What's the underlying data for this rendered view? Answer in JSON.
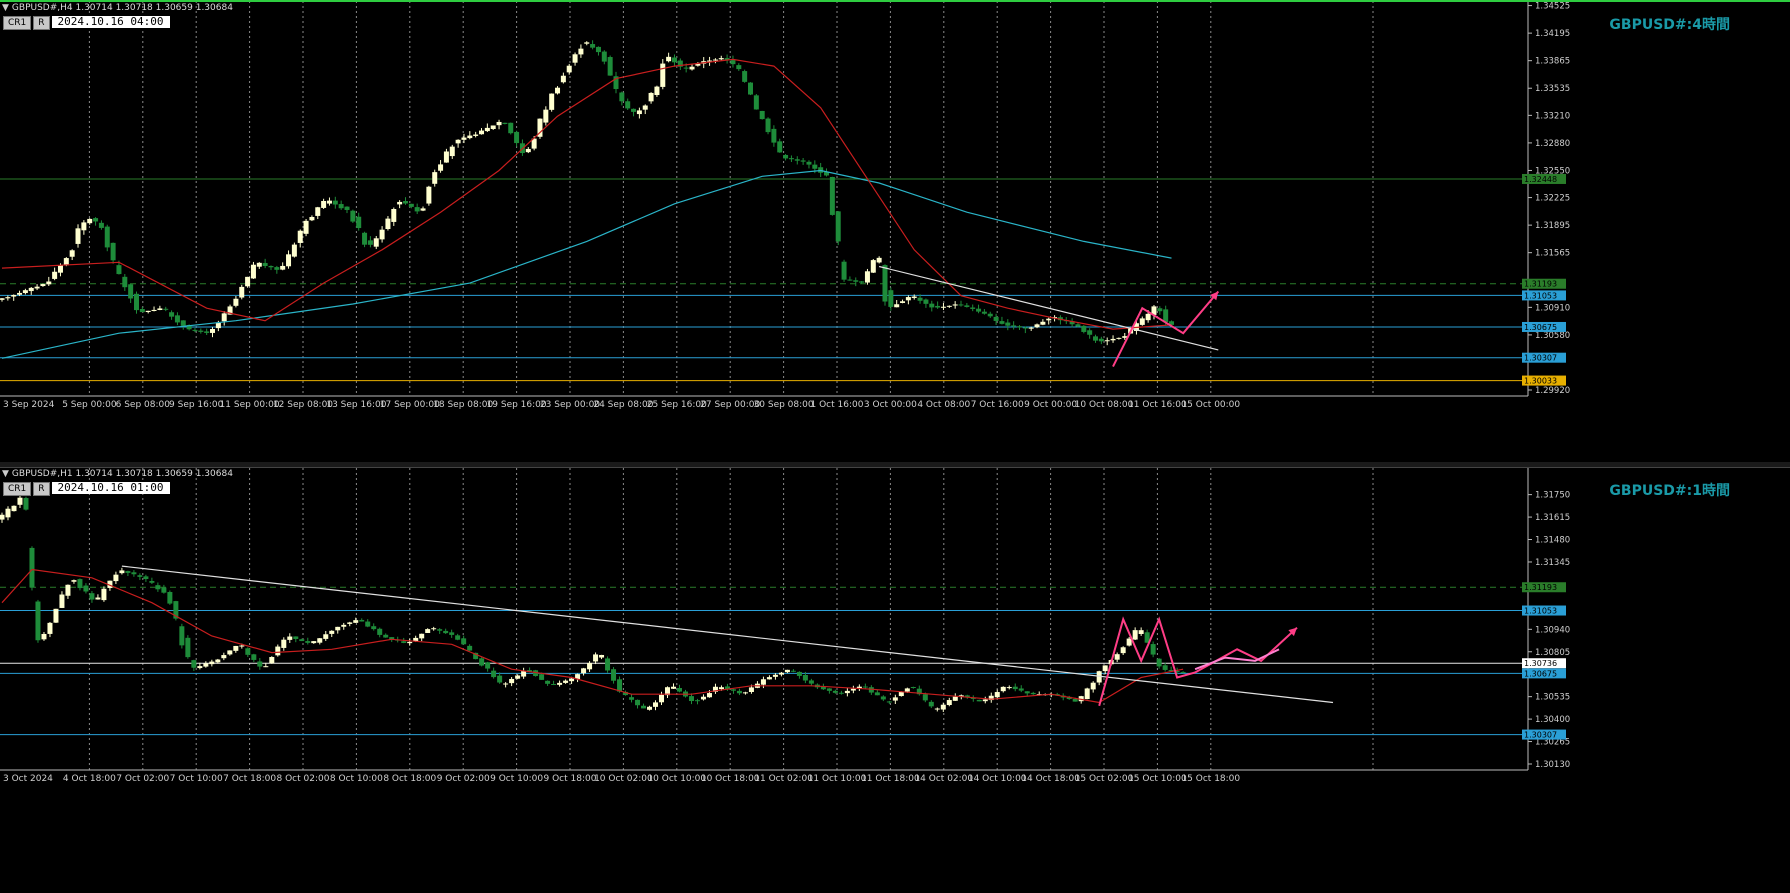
{
  "colors": {
    "bull": "#ffffd0",
    "bear": "#1e8c3a",
    "ma_short": "#c81e1e",
    "ma_long": "#2ab4c8",
    "level": "#2a9fd6",
    "green_line": "#2a7d2a",
    "trend": "#e0e0e0",
    "scenario": "#ff3d86",
    "scenario_alt": "#ff80d0",
    "low_line": "#e8b000"
  },
  "h4": {
    "header": "GBPUSD#,H4  1.30714 1.30718 1.30659 1.30684",
    "btn_cr": "CR1",
    "btn_r": "R",
    "datetime": "2024.10.16 04:00",
    "title": "GBPUSD#:4時間",
    "ylim": [
      1.2992,
      1.3452
    ],
    "y_ticks": [
      "1.34525",
      "1.34195",
      "1.33865",
      "1.33535",
      "1.33210",
      "1.32880",
      "1.32550",
      "1.32225",
      "1.31895",
      "1.31565",
      "1.30910",
      "1.30580",
      "1.29920"
    ],
    "x_labels": [
      "3 Sep 2024",
      "5 Sep 00:00",
      "6 Sep 08:00",
      "9 Sep 16:00",
      "11 Sep 00:00",
      "12 Sep 08:00",
      "13 Sep 16:00",
      "17 Sep 00:00",
      "18 Sep 08:00",
      "19 Sep 16:00",
      "23 Sep 00:00",
      "24 Sep 08:00",
      "25 Sep 16:00",
      "27 Sep 00:00",
      "30 Sep 08:00",
      "1 Oct 16:00",
      "3 Oct 00:00",
      "4 Oct 08:00",
      "7 Oct 16:00",
      "9 Oct 00:00",
      "10 Oct 08:00",
      "11 Oct 16:00",
      "15 Oct 00:00"
    ],
    "levels": [
      {
        "price": 1.32448,
        "label": "1.32448",
        "kind": "green"
      },
      {
        "price": 1.31193,
        "label": "1.31193",
        "kind": "green-dash"
      },
      {
        "price": 1.31053,
        "label": "1.31053",
        "kind": "blue"
      },
      {
        "price": 1.30675,
        "label": "1.30675",
        "kind": "blue"
      },
      {
        "price": 1.30307,
        "label": "1.30307",
        "kind": "blue"
      },
      {
        "price": 1.30033,
        "label": "1.30033",
        "kind": "yellow"
      }
    ]
  },
  "h1": {
    "header": "GBPUSD#,H1  1.30714 1.30718 1.30659 1.30684",
    "btn_cr": "CR1",
    "btn_r": "R",
    "datetime": "2024.10.16 01:00",
    "title": "GBPUSD#:1時間",
    "ylim": [
      1.3013,
      1.3185
    ],
    "y_ticks": [
      "1.31750",
      "1.31615",
      "1.31480",
      "1.31345",
      "1.30940",
      "1.30805",
      "1.30535",
      "1.30400",
      "1.30265",
      "1.30130"
    ],
    "x_labels": [
      "3 Oct 2024",
      "4 Oct 18:00",
      "7 Oct 02:00",
      "7 Oct 10:00",
      "7 Oct 18:00",
      "8 Oct 02:00",
      "8 Oct 10:00",
      "8 Oct 18:00",
      "9 Oct 02:00",
      "9 Oct 10:00",
      "9 Oct 18:00",
      "10 Oct 02:00",
      "10 Oct 10:00",
      "10 Oct 18:00",
      "11 Oct 02:00",
      "11 Oct 10:00",
      "11 Oct 18:00",
      "14 Oct 02:00",
      "14 Oct 10:00",
      "14 Oct 18:00",
      "15 Oct 02:00",
      "15 Oct 10:00",
      "15 Oct 18:00"
    ],
    "levels": [
      {
        "price": 1.31193,
        "label": "1.31193",
        "kind": "green-dash"
      },
      {
        "price": 1.31053,
        "label": "1.31053",
        "kind": "blue"
      },
      {
        "price": 1.30736,
        "label": "1.30736",
        "kind": "white"
      },
      {
        "price": 1.30675,
        "label": "1.30675",
        "kind": "blue"
      },
      {
        "price": 1.30307,
        "label": "1.30307",
        "kind": "blue"
      }
    ]
  },
  "chart_data": [
    {
      "type": "candlestick",
      "symbol": "GBPUSD#",
      "timeframe": "H4",
      "title": "GBPUSD#:4時間",
      "ylim": [
        1.2992,
        1.3452
      ],
      "path": [
        [
          0,
          1.31
        ],
        [
          8,
          1.312
        ],
        [
          12,
          1.3155
        ],
        [
          14,
          1.319
        ],
        [
          16,
          1.32
        ],
        [
          18,
          1.318
        ],
        [
          20,
          1.3135
        ],
        [
          24,
          1.3085
        ],
        [
          28,
          1.309
        ],
        [
          32,
          1.3065
        ],
        [
          36,
          1.306
        ],
        [
          40,
          1.3095
        ],
        [
          44,
          1.3145
        ],
        [
          48,
          1.3135
        ],
        [
          52,
          1.319
        ],
        [
          56,
          1.322
        ],
        [
          60,
          1.3205
        ],
        [
          63,
          1.316
        ],
        [
          66,
          1.319
        ],
        [
          68,
          1.322
        ],
        [
          72,
          1.3205
        ],
        [
          74,
          1.325
        ],
        [
          78,
          1.329
        ],
        [
          82,
          1.33
        ],
        [
          86,
          1.3315
        ],
        [
          90,
          1.327
        ],
        [
          94,
          1.334
        ],
        [
          97,
          1.3375
        ],
        [
          100,
          1.341
        ],
        [
          103,
          1.3395
        ],
        [
          106,
          1.334
        ],
        [
          109,
          1.332
        ],
        [
          112,
          1.335
        ],
        [
          114,
          1.3395
        ],
        [
          117,
          1.3375
        ],
        [
          120,
          1.3385
        ],
        [
          124,
          1.339
        ],
        [
          126,
          1.338
        ],
        [
          130,
          1.332
        ],
        [
          134,
          1.327
        ],
        [
          138,
          1.3265
        ],
        [
          142,
          1.3245
        ],
        [
          144,
          1.3125
        ],
        [
          148,
          1.312
        ],
        [
          150,
          1.316
        ],
        [
          152,
          1.309
        ],
        [
          156,
          1.3105
        ],
        [
          160,
          1.309
        ],
        [
          164,
          1.3095
        ],
        [
          168,
          1.3085
        ],
        [
          172,
          1.307
        ],
        [
          176,
          1.3065
        ],
        [
          180,
          1.308
        ],
        [
          184,
          1.307
        ],
        [
          188,
          1.305
        ],
        [
          192,
          1.3055
        ],
        [
          196,
          1.308
        ],
        [
          198,
          1.3095
        ],
        [
          200,
          1.307
        ]
      ],
      "ma_short": [
        [
          0,
          1.3138
        ],
        [
          20,
          1.3145
        ],
        [
          35,
          1.309
        ],
        [
          45,
          1.3075
        ],
        [
          55,
          1.312
        ],
        [
          65,
          1.316
        ],
        [
          75,
          1.3205
        ],
        [
          85,
          1.3255
        ],
        [
          95,
          1.332
        ],
        [
          105,
          1.3365
        ],
        [
          115,
          1.338
        ],
        [
          125,
          1.3388
        ],
        [
          132,
          1.338
        ],
        [
          140,
          1.333
        ],
        [
          148,
          1.3245
        ],
        [
          156,
          1.316
        ],
        [
          164,
          1.3105
        ],
        [
          172,
          1.309
        ],
        [
          180,
          1.3078
        ],
        [
          190,
          1.3065
        ],
        [
          200,
          1.307
        ]
      ],
      "ma_long": [
        [
          0,
          1.303
        ],
        [
          20,
          1.306
        ],
        [
          40,
          1.3075
        ],
        [
          60,
          1.3095
        ],
        [
          80,
          1.312
        ],
        [
          100,
          1.317
        ],
        [
          115,
          1.3215
        ],
        [
          130,
          1.3248
        ],
        [
          140,
          1.3255
        ],
        [
          150,
          1.324
        ],
        [
          165,
          1.3205
        ],
        [
          185,
          1.317
        ],
        [
          200,
          1.315
        ]
      ],
      "trendline": [
        [
          150,
          1.314
        ],
        [
          208,
          1.304
        ]
      ],
      "scenario": [
        [
          190,
          1.302
        ],
        [
          195,
          1.309
        ],
        [
          202,
          1.306
        ],
        [
          208,
          1.311
        ]
      ]
    },
    {
      "type": "candlestick",
      "symbol": "GBPUSD#",
      "timeframe": "H1",
      "title": "GBPUSD#:1時間",
      "ylim": [
        1.3013,
        1.3185
      ],
      "path": [
        [
          0,
          1.316
        ],
        [
          4,
          1.3175
        ],
        [
          6,
          1.3085
        ],
        [
          8,
          1.3095
        ],
        [
          12,
          1.3125
        ],
        [
          16,
          1.311
        ],
        [
          20,
          1.313
        ],
        [
          24,
          1.3125
        ],
        [
          28,
          1.3115
        ],
        [
          32,
          1.307
        ],
        [
          36,
          1.3075
        ],
        [
          40,
          1.3085
        ],
        [
          44,
          1.307
        ],
        [
          48,
          1.309
        ],
        [
          52,
          1.3085
        ],
        [
          56,
          1.3095
        ],
        [
          60,
          1.31
        ],
        [
          64,
          1.309
        ],
        [
          68,
          1.3085
        ],
        [
          72,
          1.3095
        ],
        [
          76,
          1.309
        ],
        [
          80,
          1.3075
        ],
        [
          84,
          1.306
        ],
        [
          88,
          1.307
        ],
        [
          92,
          1.306
        ],
        [
          96,
          1.3065
        ],
        [
          100,
          1.308
        ],
        [
          104,
          1.3055
        ],
        [
          108,
          1.3045
        ],
        [
          112,
          1.306
        ],
        [
          116,
          1.305
        ],
        [
          120,
          1.306
        ],
        [
          124,
          1.3055
        ],
        [
          128,
          1.3065
        ],
        [
          132,
          1.307
        ],
        [
          136,
          1.306
        ],
        [
          140,
          1.3055
        ],
        [
          144,
          1.306
        ],
        [
          148,
          1.305
        ],
        [
          152,
          1.306
        ],
        [
          156,
          1.3045
        ],
        [
          160,
          1.3055
        ],
        [
          164,
          1.305
        ],
        [
          168,
          1.306
        ],
        [
          172,
          1.3055
        ],
        [
          176,
          1.3055
        ],
        [
          180,
          1.305
        ],
        [
          184,
          1.307
        ],
        [
          188,
          1.3085
        ],
        [
          190,
          1.3095
        ],
        [
          192,
          1.308
        ],
        [
          194,
          1.307
        ],
        [
          197,
          1.3068
        ]
      ],
      "ma_short": [
        [
          0,
          1.311
        ],
        [
          5,
          1.313
        ],
        [
          15,
          1.3125
        ],
        [
          25,
          1.311
        ],
        [
          35,
          1.309
        ],
        [
          45,
          1.308
        ],
        [
          55,
          1.3082
        ],
        [
          65,
          1.3088
        ],
        [
          75,
          1.3085
        ],
        [
          85,
          1.307
        ],
        [
          95,
          1.3065
        ],
        [
          105,
          1.3055
        ],
        [
          115,
          1.3055
        ],
        [
          125,
          1.306
        ],
        [
          135,
          1.306
        ],
        [
          145,
          1.3058
        ],
        [
          155,
          1.3055
        ],
        [
          165,
          1.3052
        ],
        [
          175,
          1.3055
        ],
        [
          183,
          1.305
        ],
        [
          190,
          1.3065
        ],
        [
          197,
          1.307
        ]
      ],
      "trendline": [
        [
          20,
          1.3132
        ],
        [
          222,
          1.305
        ]
      ],
      "scenario": [
        [
          183,
          1.3048
        ],
        [
          187,
          1.31
        ],
        [
          190,
          1.3075
        ],
        [
          193,
          1.31
        ],
        [
          196,
          1.3065
        ],
        [
          199,
          1.3068
        ],
        [
          206,
          1.3082
        ],
        [
          210,
          1.3075
        ],
        [
          216,
          1.3095
        ]
      ],
      "scenario_alt": [
        [
          199,
          1.307
        ],
        [
          204,
          1.3077
        ],
        [
          209,
          1.3075
        ],
        [
          213,
          1.3082
        ]
      ]
    }
  ]
}
